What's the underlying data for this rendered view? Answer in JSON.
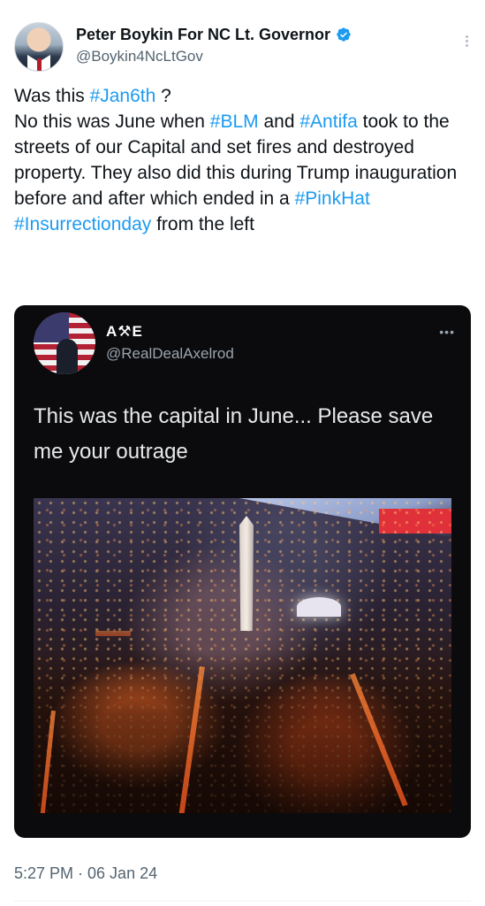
{
  "tweet": {
    "author_name": "Peter Boykin For NC Lt. Governor",
    "author_handle": "@Boykin4NcLtGov",
    "verified_icon": "verified-badge-icon",
    "more_icon": "more-options-icon",
    "text": {
      "line1_a": "Was this ",
      "tag_jan6": "#Jan6th",
      "line1_b": " ?",
      "line2_a": "No this was June when ",
      "tag_blm": "#BLM",
      "line2_b": " and ",
      "tag_antifa": "#Antifa",
      "line3": "took to the streets of our Capital and set fires and destroyed property. They also did this during Trump inauguration before and after which ended in a ",
      "tag_pinkhat": "#PinkHat",
      "space": " ",
      "tag_insurrection": "#Insurrectionday",
      "line_end": " from the left"
    },
    "timestamp": "5:27 PM · 06 Jan 24"
  },
  "embedded": {
    "author_name": "A⚒E",
    "author_handle": "@RealDealAxelrod",
    "more_icon": "more-options-icon",
    "text": "This was the capital in June...  Please save me your outrage",
    "photo_icon": "capital-night-fire-photo"
  },
  "colors": {
    "link": "#1d9bf0",
    "verified": "#1d9bf0",
    "embed_bg": "#0b0b0d"
  }
}
